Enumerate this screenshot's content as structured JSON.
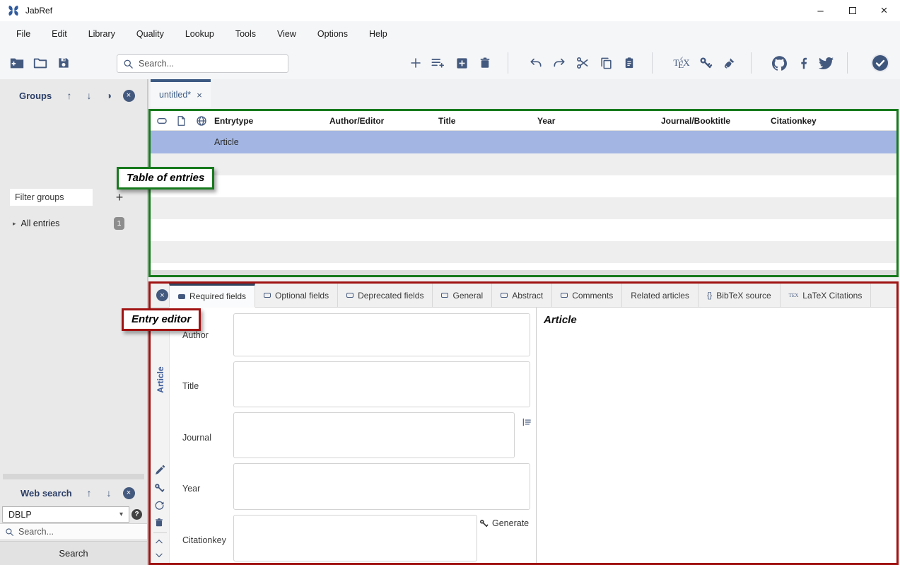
{
  "window": {
    "title": "JabRef"
  },
  "window_controls": {
    "minimize": "–",
    "close": "×"
  },
  "menubar": {
    "items": [
      "File",
      "Edit",
      "Library",
      "Quality",
      "Lookup",
      "Tools",
      "View",
      "Options",
      "Help"
    ]
  },
  "toolbar": {
    "search_placeholder": "Search...",
    "tex": [
      "T",
      "E",
      "X"
    ]
  },
  "icons": {
    "up_arrow": "↑",
    "down_arrow": "↓",
    "half_circle": "◑",
    "close_x": "×",
    "caret_down": "▾",
    "expand_right": "▸",
    "plus": "+",
    "help": "?",
    "braces": "{}",
    "tex_small": "TEX",
    "quill": "☇"
  },
  "sidebar": {
    "groups": {
      "title": "Groups",
      "filter_placeholder": "Filter groups",
      "all_entries": "All entries",
      "count": "1"
    },
    "web_search": {
      "title": "Web search",
      "fetcher": "DBLP",
      "search_placeholder": "Search...",
      "button": "Search"
    }
  },
  "library_tab": {
    "label": "untitled*"
  },
  "entry_table": {
    "columns": [
      "Entrytype",
      "Author/Editor",
      "Title",
      "Year",
      "Journal/Booktitle",
      "Citationkey"
    ],
    "selected_row": {
      "entrytype": "Article"
    }
  },
  "annotations": {
    "table": "Table of entries",
    "editor": "Entry editor"
  },
  "entry_editor": {
    "tabs": [
      "Required fields",
      "Optional fields",
      "Deprecated fields",
      "General",
      "Abstract",
      "Comments",
      "Related articles",
      "BibTeX source",
      "LaTeX Citations"
    ],
    "entry_type": "Article",
    "fields": [
      "Author",
      "Title",
      "Journal",
      "Year",
      "Citationkey"
    ],
    "generate": "Generate",
    "preview_heading": "Article"
  },
  "colors": {
    "accent": "#44597e",
    "selection": "#a3b6e3",
    "annotation_green": "#177a1d",
    "annotation_red": "#a01212"
  }
}
